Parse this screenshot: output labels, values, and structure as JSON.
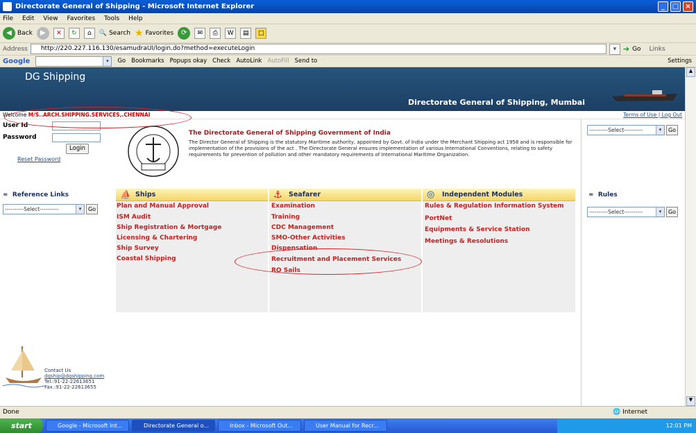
{
  "window": {
    "title": "Directorate General of Shipping - Microsoft Internet Explorer"
  },
  "menu": [
    "File",
    "Edit",
    "View",
    "Favorites",
    "Tools",
    "Help"
  ],
  "toolbar": {
    "back": "Back",
    "search": "Search",
    "favorites": "Favorites"
  },
  "address": {
    "label": "Address",
    "url": "http://220.227.116.130/esamudraUI/login.do?method=executeLogin",
    "go": "Go",
    "links": "Links"
  },
  "googlebar": {
    "brand": "Google",
    "go": "Go",
    "bookmarks": "Bookmarks",
    "popups": "Popups okay",
    "check": "Check",
    "autolink": "AutoLink",
    "autofill": "AutoFill",
    "sendto": "Send to",
    "settings": "Settings"
  },
  "site": {
    "title": "DG Shipping",
    "subtitle": "Directorate General of Shipping, Mumbai"
  },
  "welcome": {
    "prefix": "Welcome",
    "name": "M/S..ARCH.SHIPPING.SERVICES,.CHENNAI",
    "terms": "Terms of Use",
    "logout": "Log Out"
  },
  "login": {
    "user_label": "User Id",
    "password_label": "Password",
    "login_button": "Login",
    "reset": "Reset Password"
  },
  "intro": {
    "heading": "The Directorate General of Shipping Government of India",
    "body": "The Director General of Shipping is the statutory Maritime authority, appointed by Govt. of India under the Merchant Shipping act 1958 and is responsible for implementation of the provisions of the act . The Directorate General ensures implementation of various International Conventions, relating to safety requirements for prevention of pollution and other mandatory requirements of International Maritime Organization."
  },
  "reference": {
    "label": "Reference Links",
    "select": "----------Select----------",
    "go": "Go"
  },
  "rules": {
    "label": "Rules",
    "select": "----------Select----------",
    "go": "Go"
  },
  "top_select": {
    "select": "----------Select----------",
    "go": "Go"
  },
  "sections": {
    "ships": {
      "title": "Ships",
      "items": [
        "Plan and Manual Approval",
        "ISM Audit",
        "Ship Registration & Mortgage",
        "Licensing & Chartering",
        "Ship Survey",
        "Coastal Shipping"
      ]
    },
    "seafarer": {
      "title": "Seafarer",
      "items": [
        "Examination",
        "Training",
        "CDC Management",
        "SMO-Other Activities",
        "Dispensation",
        "Recruitment and Placement Services",
        "RO Sails"
      ]
    },
    "modules": {
      "title": "Independent Modules",
      "items": [
        "Rules & Regulation Information System",
        "PortNet",
        "Equipments & Service Station",
        "Meetings & Resolutions"
      ]
    }
  },
  "contact": {
    "title": "Contact Us",
    "email": "dgship@dgshipping.com",
    "tel": "Tel.:91-22-22613651",
    "fax": "Fax.:91-22-22613655"
  },
  "status": {
    "left": "Done",
    "zone": "Internet"
  },
  "taskbar": {
    "start": "start",
    "items": [
      "Google - Microsoft Int...",
      "Directorate General o...",
      "Inbox - Microsoft Out...",
      "User Manual for Recr..."
    ],
    "clock": "12:01 PM"
  }
}
